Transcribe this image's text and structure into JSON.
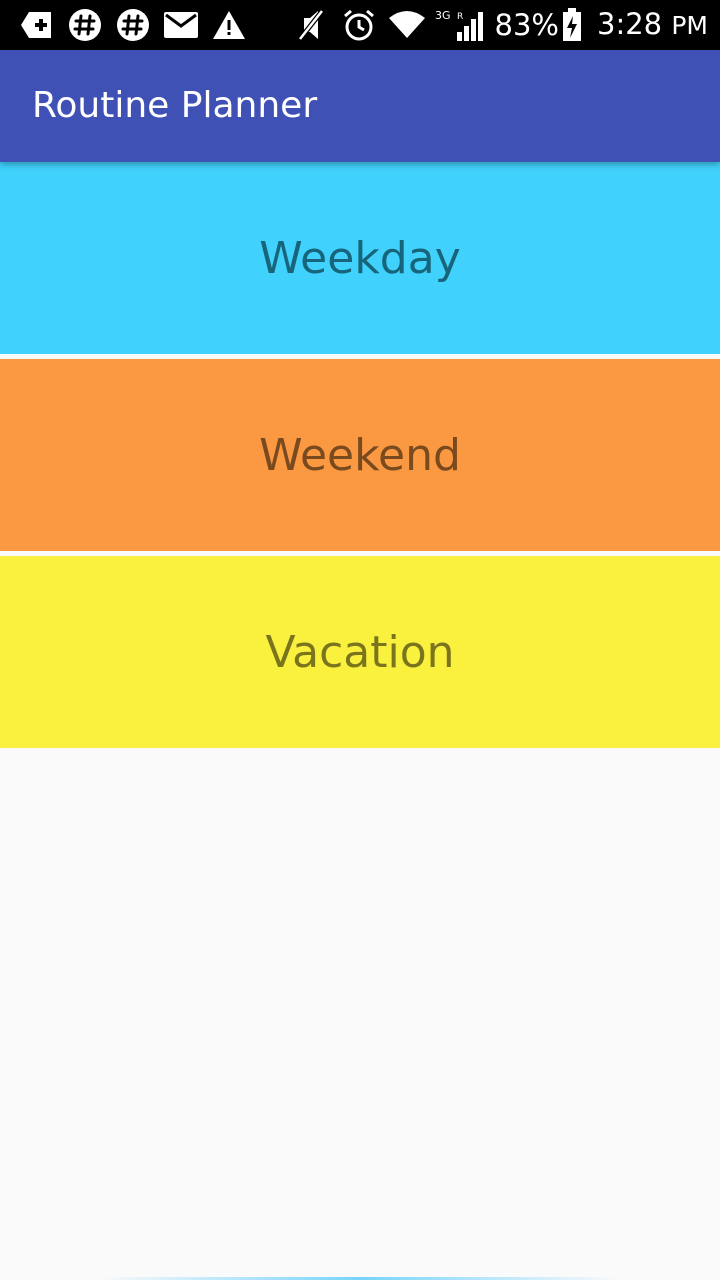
{
  "status_bar": {
    "left_icons": [
      "add-notification-icon",
      "slack-icon",
      "slack-icon",
      "gmail-icon",
      "warning-icon"
    ],
    "right_icons": [
      "mute-icon",
      "alarm-icon",
      "wifi-icon",
      "signal-3g-icon"
    ],
    "battery_percent": "83%",
    "time": "3:28",
    "ampm": "PM"
  },
  "app_bar": {
    "title": "Routine Planner",
    "color": "#3f51b5"
  },
  "routines": [
    {
      "label": "Weekday",
      "bg": "#40d2fc",
      "fg": "#17647b"
    },
    {
      "label": "Weekend",
      "bg": "#fb9842",
      "fg": "#7a4a1f"
    },
    {
      "label": "Vacation",
      "bg": "#faf03e",
      "fg": "#7a741d"
    }
  ]
}
